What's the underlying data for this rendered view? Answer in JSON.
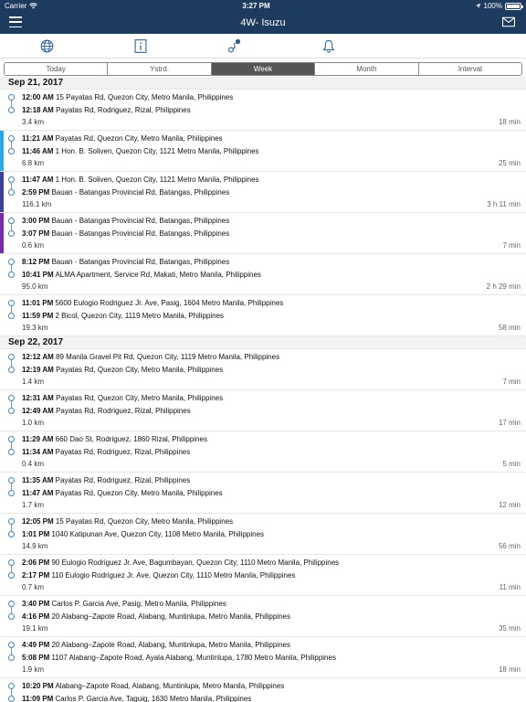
{
  "status": {
    "carrier": "Carrier",
    "time": "3:27 PM",
    "battery": "100%"
  },
  "nav": {
    "title": "4W- Isuzu"
  },
  "tabs": [
    {
      "label": "Today"
    },
    {
      "label": "Ystrd."
    },
    {
      "label": "Week"
    },
    {
      "label": "Month"
    },
    {
      "label": "Interval"
    }
  ],
  "days": [
    {
      "date": "Sep 21, 2017",
      "trips": [
        {
          "start_time": "12:00 AM",
          "start_addr": "15 Payatas Rd, Quezon City, Metro Manila, Philippines",
          "end_time": "12:18 AM",
          "end_addr": "Payatas Rd, Rodriguez, Rizal, Philippines",
          "distance": "3.4 km",
          "duration": "18 min",
          "bar": ""
        },
        {
          "start_time": "11:21 AM",
          "start_addr": "Payatas Rd, Quezon City, Metro Manila, Philippines",
          "end_time": "11:46 AM",
          "end_addr": "1 Hon. B. Soliven, Quezon City, 1121 Metro Manila, Philippines",
          "distance": "6.8 km",
          "duration": "25 min",
          "bar": "#29a8e8"
        },
        {
          "start_time": "11:47 AM",
          "start_addr": "1 Hon. B. Soliven, Quezon City, 1121 Metro Manila, Philippines",
          "end_time": "2:59 PM",
          "end_addr": "Bauan - Batangas Provincial Rd, Batangas, Philippines",
          "distance": "116.1 km",
          "duration": "3 h 11 min",
          "bar": "#3a3f9a"
        },
        {
          "start_time": "3:00 PM",
          "start_addr": "Bauan - Batangas Provincial Rd, Batangas, Philippines",
          "end_time": "3:07 PM",
          "end_addr": "Bauan - Batangas Provincial Rd, Batangas, Philippines",
          "distance": "0.6 km",
          "duration": "7 min",
          "bar": "#7a2aa8"
        },
        {
          "start_time": "8:12 PM",
          "start_addr": "Bauan - Batangas Provincial Rd, Batangas, Philippines",
          "end_time": "10:41 PM",
          "end_addr": "ALMA Apartment, Service Rd, Makati, Metro Manila, Philippines",
          "distance": "95.0 km",
          "duration": "2 h 29 min",
          "bar": ""
        },
        {
          "start_time": "11:01 PM",
          "start_addr": "5600 Eulogio Rodriguez Jr. Ave, Pasig, 1604 Metro Manila, Philippines",
          "end_time": "11:59 PM",
          "end_addr": "2 Bicol, Quezon City, 1119 Metro Manila, Philippines",
          "distance": "19.3 km",
          "duration": "58 min",
          "bar": ""
        }
      ]
    },
    {
      "date": "Sep 22, 2017",
      "trips": [
        {
          "start_time": "12:12 AM",
          "start_addr": "89 Manila Gravel Pit Rd, Quezon City, 1119 Metro Manila, Philippines",
          "end_time": "12:19 AM",
          "end_addr": "Payatas Rd, Quezon City, Metro Manila, Philippines",
          "distance": "1.4 km",
          "duration": "7 min",
          "bar": ""
        },
        {
          "start_time": "12:31 AM",
          "start_addr": "Payatas Rd, Quezon City, Metro Manila, Philippines",
          "end_time": "12:49 AM",
          "end_addr": "Payatas Rd, Rodriguez, Rizal, Philippines",
          "distance": "1.0 km",
          "duration": "17 min",
          "bar": ""
        },
        {
          "start_time": "11:29 AM",
          "start_addr": "660 Dao St, Rodriguez, 1860 Rizal, Philippines",
          "end_time": "11:34 AM",
          "end_addr": "Payatas Rd, Rodriguez, Rizal, Philippines",
          "distance": "0.4 km",
          "duration": "5 min",
          "bar": ""
        },
        {
          "start_time": "11:35 AM",
          "start_addr": "Payatas Rd, Rodriguez, Rizal, Philippines",
          "end_time": "11:47 AM",
          "end_addr": "Payatas Rd, Quezon City, Metro Manila, Philippines",
          "distance": "1.7 km",
          "duration": "12 min",
          "bar": ""
        },
        {
          "start_time": "12:05 PM",
          "start_addr": "15 Payatas Rd, Quezon City, Metro Manila, Philippines",
          "end_time": "1:01 PM",
          "end_addr": "1040 Katipunan Ave, Quezon City, 1108 Metro Manila, Philippines",
          "distance": "14.9 km",
          "duration": "56 min",
          "bar": ""
        },
        {
          "start_time": "2:06 PM",
          "start_addr": "90 Eulogio Rodriguez Jr. Ave, Bagumbayan, Quezon City, 1110 Metro Manila, Philippines",
          "end_time": "2:17 PM",
          "end_addr": "110 Eulogio Rodriguez Jr. Ave, Quezon City, 1110 Metro Manila, Philippines",
          "distance": "0.7 km",
          "duration": "11 min",
          "bar": ""
        },
        {
          "start_time": "3:40 PM",
          "start_addr": "Carlos P. Garcia Ave, Pasig, Metro Manila, Philippines",
          "end_time": "4:16 PM",
          "end_addr": "20 Alabang–Zapote Road, Alabang, Muntinlupa, Metro Manila, Philippines",
          "distance": "19.1 km",
          "duration": "35 min",
          "bar": ""
        },
        {
          "start_time": "4:49 PM",
          "start_addr": "20 Alabang–Zapote Road, Alabang, Muntinlupa, Metro Manila, Philippines",
          "end_time": "5:08 PM",
          "end_addr": "1107 Alabang–Zapote Road, Ayala Alabang, Muntinlupa, 1780 Metro Manila, Philippines",
          "distance": "1.9 km",
          "duration": "18 min",
          "bar": ""
        },
        {
          "start_time": "10:20 PM",
          "start_addr": "Alabang–Zapote Road, Alabang, Muntinlupa, Metro Manila, Philippines",
          "end_time": "11:09 PM",
          "end_addr": "Carlos P. Garcia Ave, Taguig, 1630 Metro Manila, Philippines",
          "distance": "",
          "duration": "",
          "bar": ""
        }
      ]
    }
  ]
}
